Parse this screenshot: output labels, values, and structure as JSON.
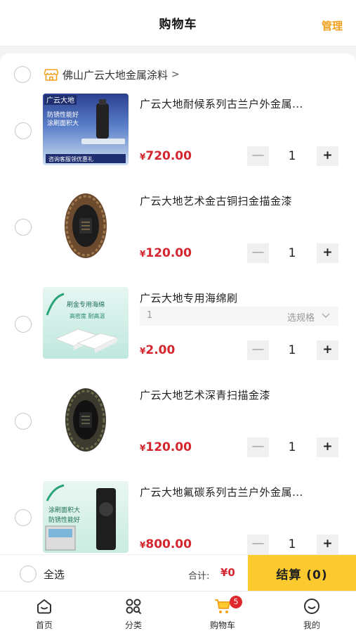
{
  "header": {
    "title": "购物车",
    "manage": "管理"
  },
  "shop": {
    "name": "佛山广云大地金属涂料",
    "arrow": ">"
  },
  "items": [
    {
      "name": "广云大地耐候系列古兰户外金属...",
      "price_symbol": "¥",
      "price": "720.00",
      "qty": "1",
      "thumb": {
        "banner": "广云大地",
        "line1": "防锈性能好",
        "line2": "涂刷面积大",
        "footer": "咨询客服领优惠礼"
      }
    },
    {
      "name": "广云大地艺术金古铜扫金描金漆",
      "price_symbol": "¥",
      "price": "120.00",
      "qty": "1"
    },
    {
      "name": "广云大地专用海绵刷",
      "price_symbol": "¥",
      "price": "2.00",
      "qty": "1",
      "spec": {
        "value": "1",
        "placeholder": "选规格"
      },
      "thumb": {
        "line1": "刷金专用海绵",
        "line2": "高密度 耐高温"
      }
    },
    {
      "name": "广云大地艺术深青扫描金漆",
      "price_symbol": "¥",
      "price": "120.00",
      "qty": "1"
    },
    {
      "name": "广云大地氟碳系列古兰户外金属...",
      "price_symbol": "¥",
      "price": "800.00",
      "qty": "1",
      "thumb": {
        "line1": "涂刷面积大",
        "line2": "防锈性能好"
      }
    }
  ],
  "stepper": {
    "minus": "—",
    "plus": "+"
  },
  "checkout": {
    "select_all": "全选",
    "total_label": "合计:",
    "total_value": "¥0",
    "settle_label": "结算 (0)"
  },
  "tabbar": [
    {
      "label": "首页",
      "icon": "home-icon"
    },
    {
      "label": "分类",
      "icon": "category-icon"
    },
    {
      "label": "购物车",
      "icon": "cart-icon",
      "badge": "5"
    },
    {
      "label": "我的",
      "icon": "profile-icon"
    }
  ],
  "colors": {
    "accent": "#f0a01c",
    "price": "#d3262e",
    "settle": "#fcc92e",
    "badge": "#e0282c"
  }
}
